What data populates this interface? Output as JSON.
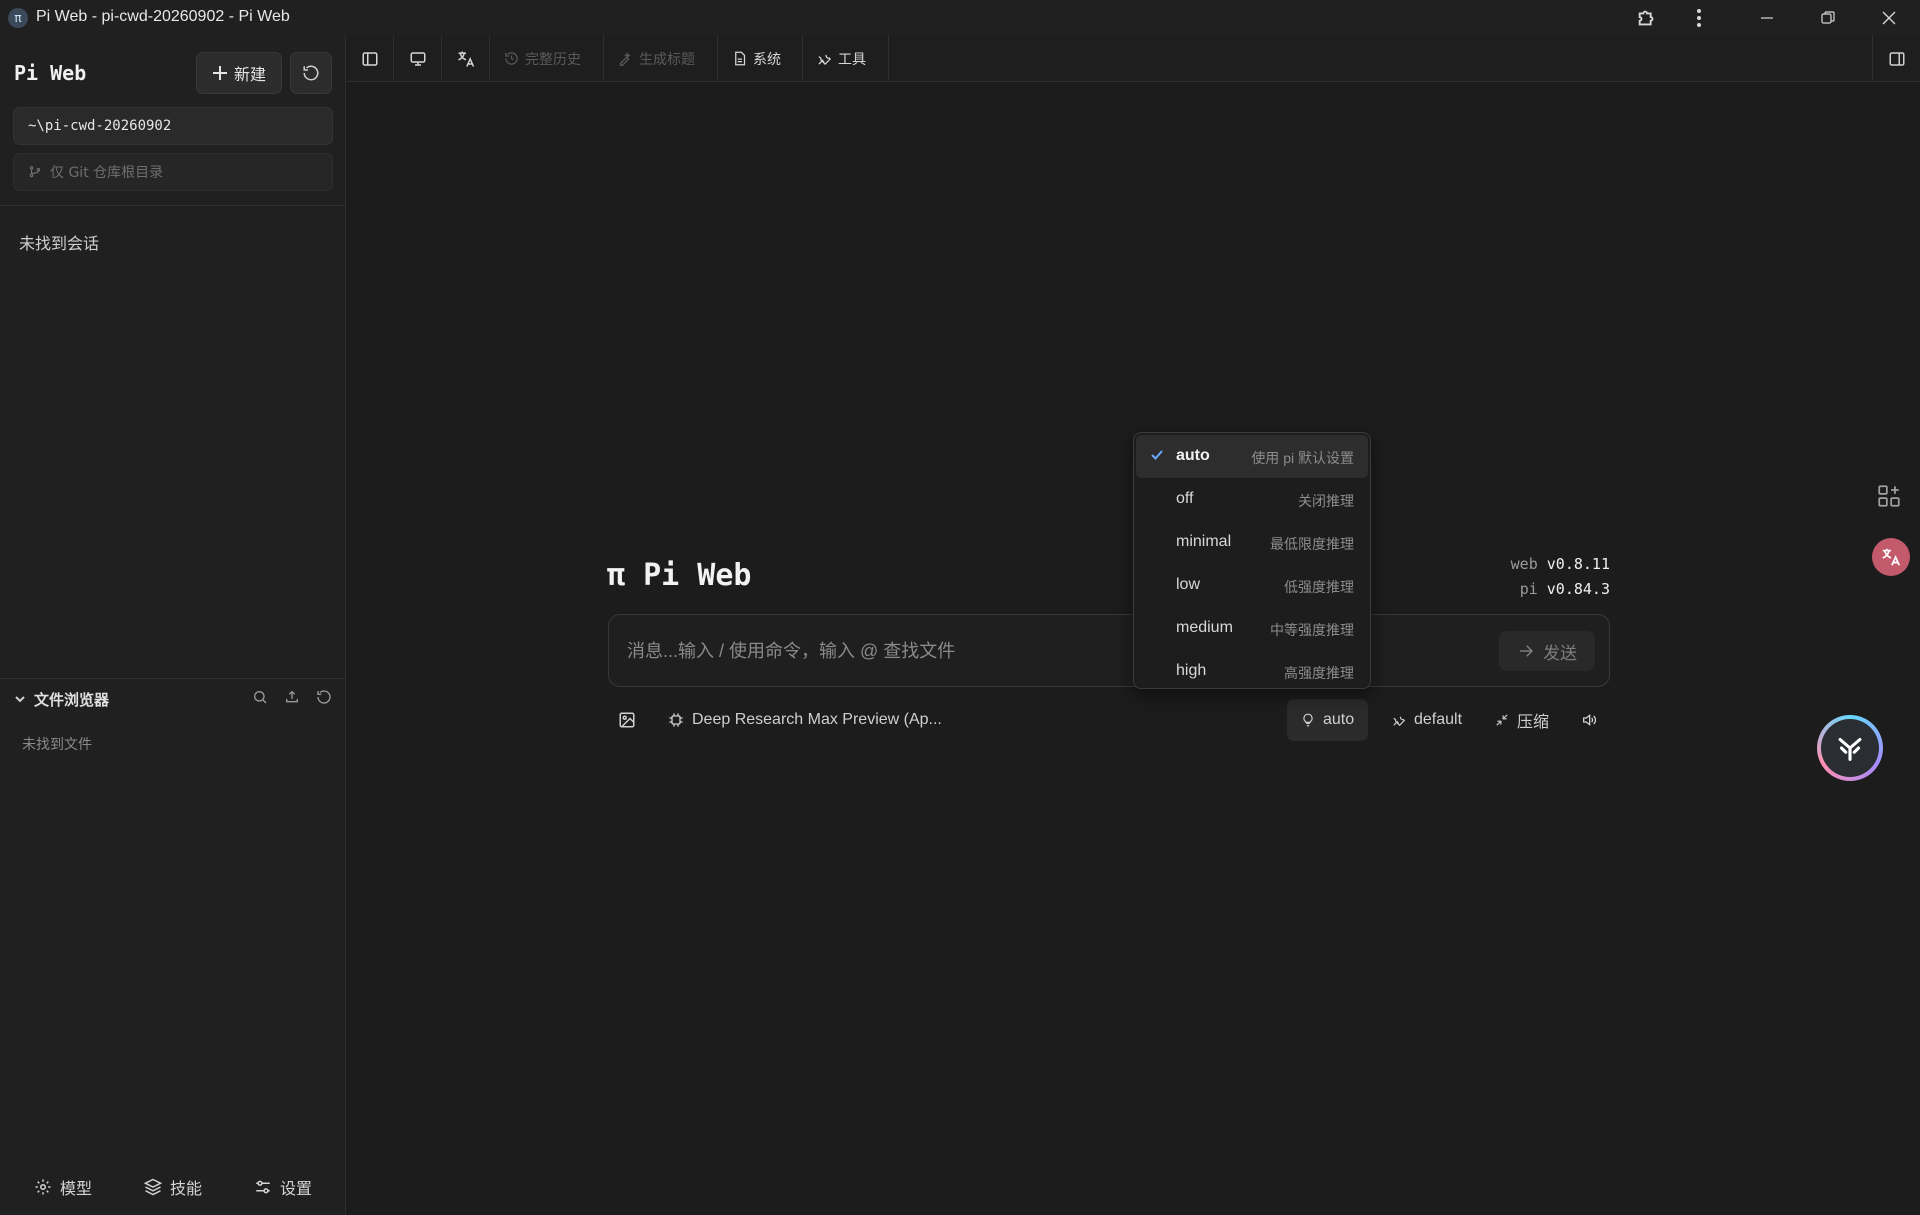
{
  "window": {
    "title": "Pi Web - pi-cwd-20260902 - Pi Web",
    "app_icon_glyph": "π"
  },
  "sidebar": {
    "brand": "Pi Web",
    "new_label": "新建",
    "cwd_value": "~\\pi-cwd-20260902",
    "git_filter_placeholder": "仅 Git 仓库根目录",
    "empty_sessions": "未找到会话",
    "file_browser": {
      "title": "文件浏览器",
      "empty": "未找到文件"
    },
    "bottom_nav": [
      {
        "label": "模型",
        "icon": "gear-icon"
      },
      {
        "label": "技能",
        "icon": "layers-icon"
      },
      {
        "label": "设置",
        "icon": "sliders-icon"
      }
    ]
  },
  "toolbar": {
    "full_history": "完整历史",
    "generate_title": "生成标题",
    "system": "系统",
    "tools": "工具"
  },
  "main": {
    "hero_glyph": "π",
    "hero_title": "Pi Web",
    "versions": {
      "web_label": "web",
      "web_version": "v0.8.11",
      "pi_label": "pi",
      "pi_version": "v0.84.3"
    },
    "composer": {
      "placeholder": "消息...输入 / 使用命令，输入 @ 查找文件",
      "send_label": "发送"
    },
    "composer_bar": {
      "model": "Deep Research Max Preview (Ap...",
      "thinking": "auto",
      "mode": "default",
      "compress": "压缩"
    }
  },
  "thinking_menu": {
    "selected": "auto",
    "options": [
      {
        "label": "auto",
        "desc": "使用 pi 默认设置"
      },
      {
        "label": "off",
        "desc": "关闭推理"
      },
      {
        "label": "minimal",
        "desc": "最低限度推理"
      },
      {
        "label": "low",
        "desc": "低强度推理"
      },
      {
        "label": "medium",
        "desc": "中等强度推理"
      },
      {
        "label": "high",
        "desc": "高强度推理"
      }
    ]
  },
  "colors": {
    "background": "#1c1c1c",
    "sidebar": "#202020",
    "accent_check": "#6aa8ff",
    "translate_badge": "#c25a6c"
  }
}
